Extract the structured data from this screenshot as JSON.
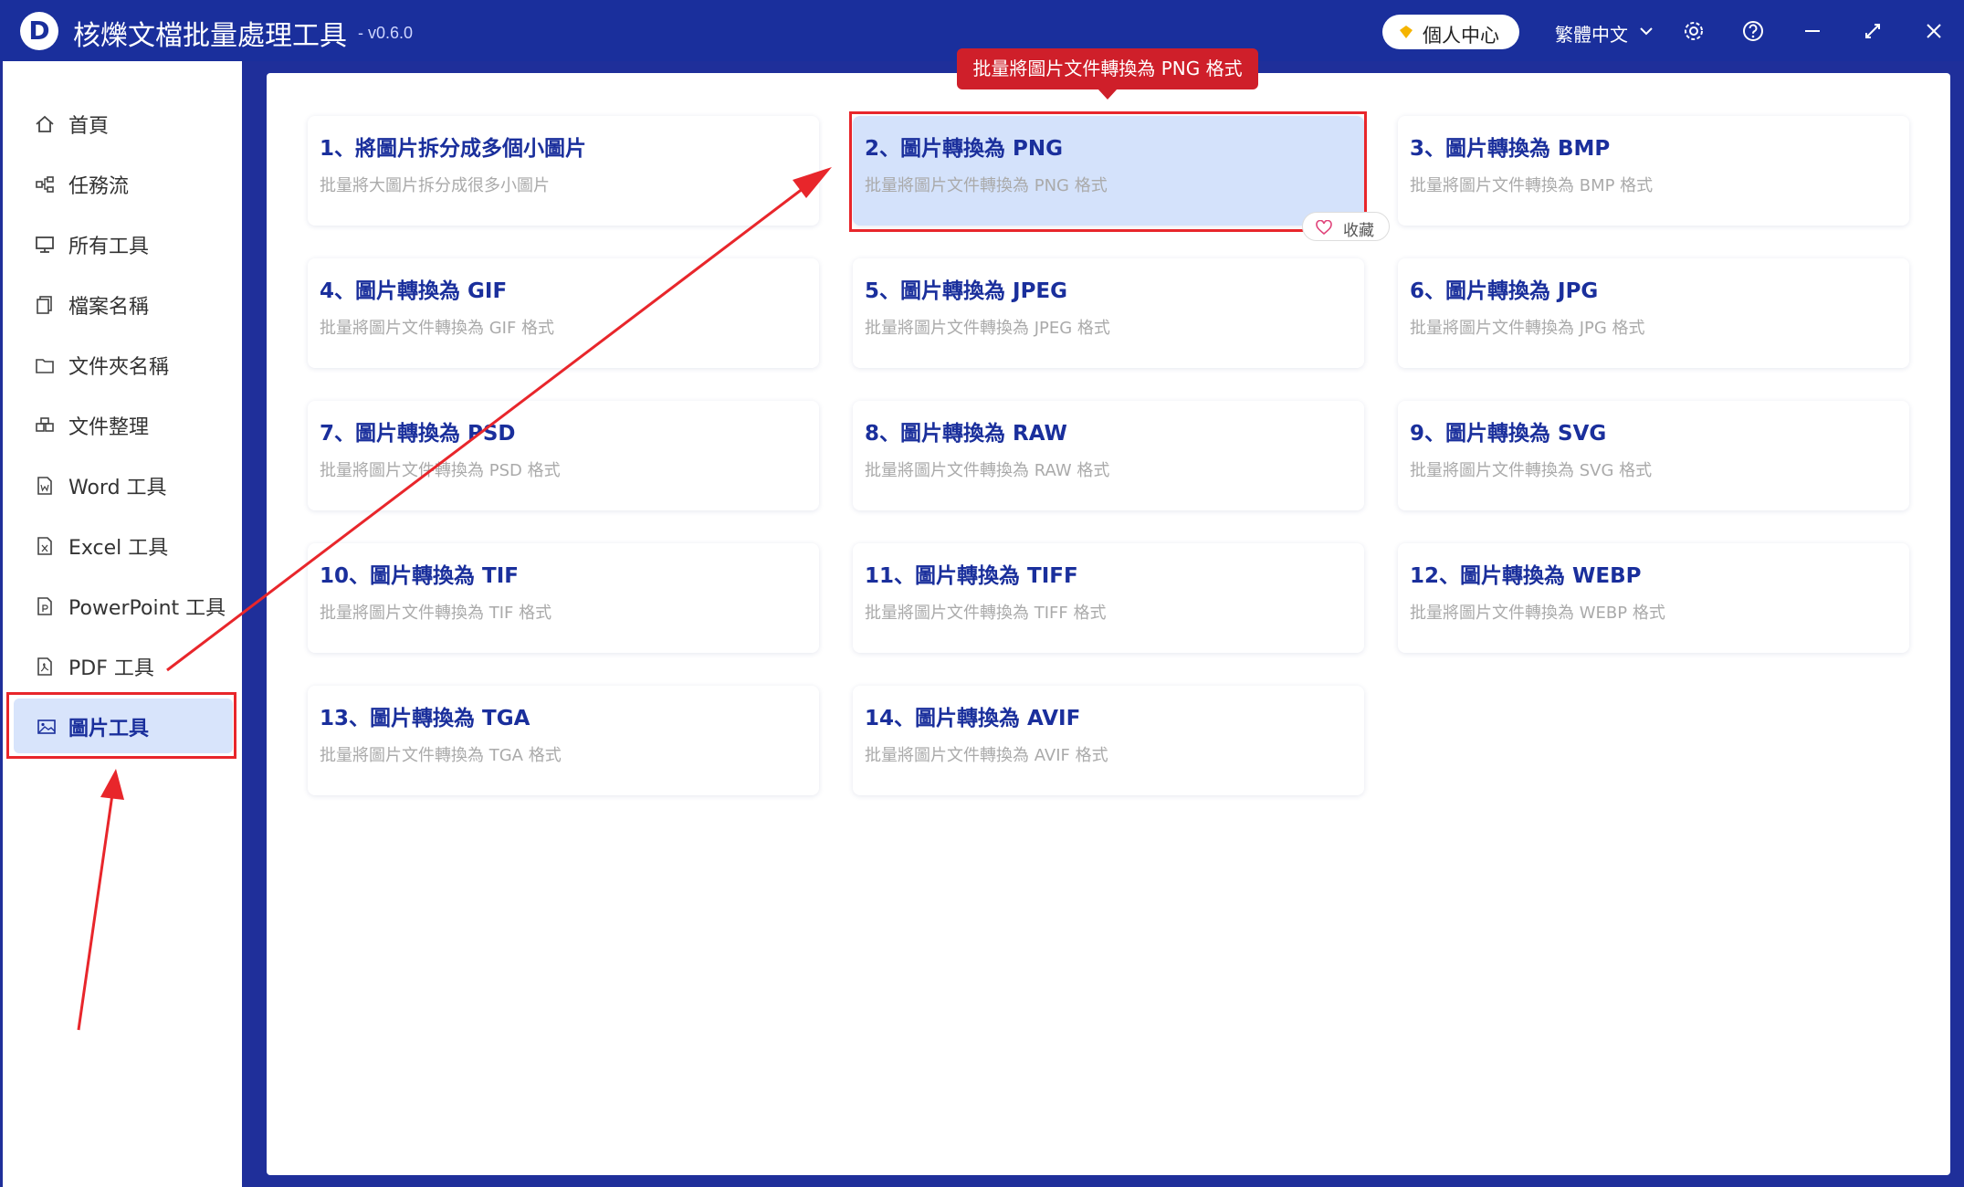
{
  "app": {
    "logo_letter": "D",
    "title": "核爍文檔批量處理工具",
    "version": "- v0.6.0",
    "user_center": "個人中心",
    "language": "繁體中文"
  },
  "sidebar": {
    "items": [
      {
        "label": "首頁",
        "icon": "home-icon"
      },
      {
        "label": "任務流",
        "icon": "workflow-icon"
      },
      {
        "label": "所有工具",
        "icon": "monitor-icon"
      },
      {
        "label": "檔案名稱",
        "icon": "file-copy-icon"
      },
      {
        "label": "文件夾名稱",
        "icon": "folder-icon"
      },
      {
        "label": "文件整理",
        "icon": "organize-icon"
      },
      {
        "label": "Word 工具",
        "icon": "word-file-icon"
      },
      {
        "label": "Excel 工具",
        "icon": "excel-file-icon"
      },
      {
        "label": "PowerPoint 工具",
        "icon": "ppt-file-icon"
      },
      {
        "label": "PDF 工具",
        "icon": "pdf-file-icon"
      },
      {
        "label": "圖片工具",
        "icon": "image-icon"
      }
    ],
    "active_index": 10
  },
  "tools": [
    {
      "title": "1、將圖片拆分成多個小圖片",
      "desc": "批量將大圖片拆分成很多小圖片"
    },
    {
      "title": "2、圖片轉換為 PNG",
      "desc": "批量將圖片文件轉換為 PNG 格式"
    },
    {
      "title": "3、圖片轉換為 BMP",
      "desc": "批量將圖片文件轉換為 BMP 格式"
    },
    {
      "title": "4、圖片轉換為 GIF",
      "desc": "批量將圖片文件轉換為 GIF 格式"
    },
    {
      "title": "5、圖片轉換為 JPEG",
      "desc": "批量將圖片文件轉換為 JPEG 格式"
    },
    {
      "title": "6、圖片轉換為 JPG",
      "desc": "批量將圖片文件轉換為 JPG 格式"
    },
    {
      "title": "7、圖片轉換為 PSD",
      "desc": "批量將圖片文件轉換為 PSD 格式"
    },
    {
      "title": "8、圖片轉換為 RAW",
      "desc": "批量將圖片文件轉換為 RAW 格式"
    },
    {
      "title": "9、圖片轉換為 SVG",
      "desc": "批量將圖片文件轉換為 SVG 格式"
    },
    {
      "title": "10、圖片轉換為 TIF",
      "desc": "批量將圖片文件轉換為 TIF 格式"
    },
    {
      "title": "11、圖片轉換為 TIFF",
      "desc": "批量將圖片文件轉換為 TIFF 格式"
    },
    {
      "title": "12、圖片轉換為 WEBP",
      "desc": "批量將圖片文件轉換為 WEBP 格式"
    },
    {
      "title": "13、圖片轉換為 TGA",
      "desc": "批量將圖片文件轉換為 TGA 格式"
    },
    {
      "title": "14、圖片轉換為 AVIF",
      "desc": "批量將圖片文件轉換為 AVIF 格式"
    }
  ],
  "selected_tool_index": 1,
  "favorite_label": "收藏",
  "tooltip": "批量將圖片文件轉換為 PNG 格式",
  "colors": {
    "titlebar": "#1a2f9c",
    "accent": "#1a2f9c",
    "annotation_red": "#e8262b",
    "selected_card": "#d4e2fb"
  }
}
